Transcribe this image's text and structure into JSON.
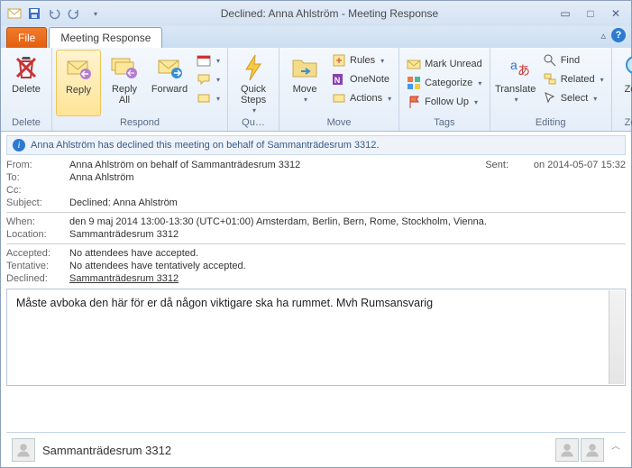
{
  "window": {
    "title": "Declined: Anna Ahlström  -  Meeting Response"
  },
  "tabs": {
    "file": "File",
    "meeting_response": "Meeting Response"
  },
  "ribbon": {
    "delete": {
      "label": "Delete",
      "group": "Delete"
    },
    "respond": {
      "reply": "Reply",
      "reply_all": "Reply\nAll",
      "forward": "Forward",
      "group": "Respond"
    },
    "quick_steps": {
      "label": "Quick\nSteps",
      "group": "Qu…"
    },
    "move": {
      "move": "Move",
      "rules": "Rules",
      "onenote": "OneNote",
      "actions": "Actions",
      "group": "Move"
    },
    "tags": {
      "mark_unread": "Mark Unread",
      "categorize": "Categorize",
      "follow_up": "Follow Up",
      "group": "Tags"
    },
    "translate": {
      "label": "Translate"
    },
    "editing": {
      "find": "Find",
      "related": "Related",
      "select": "Select",
      "group": "Editing"
    },
    "zoom": {
      "label": "Zoom",
      "group": "Zoom"
    }
  },
  "info_bar": "Anna Ahlström has declined this meeting on behalf of Sammanträdesrum 3312.",
  "headers": {
    "from_label": "From:",
    "from_value": "Anna Ahlström on behalf of Sammanträdesrum 3312",
    "sent_label": "Sent:",
    "sent_value": "on 2014-05-07 15:32",
    "to_label": "To:",
    "to_value": "Anna Ahlström",
    "cc_label": "Cc:",
    "cc_value": "",
    "subject_label": "Subject:",
    "subject_value": "Declined: Anna Ahlström",
    "when_label": "When:",
    "when_value": "den 9 maj 2014 13:00-13:30 (UTC+01:00) Amsterdam, Berlin, Bern, Rome, Stockholm, Vienna.",
    "location_label": "Location:",
    "location_value": "Sammanträdesrum 3312",
    "accepted_label": "Accepted:",
    "accepted_value": "No attendees have accepted.",
    "tentative_label": "Tentative:",
    "tentative_value": "No attendees have tentatively accepted.",
    "declined_label": "Declined:",
    "declined_value": "Sammanträdesrum 3312"
  },
  "body": "Måste avboka den här för er då någon viktigare ska ha rummet. Mvh Rumsansvarig",
  "footer": {
    "name": "Sammanträdesrum 3312"
  }
}
